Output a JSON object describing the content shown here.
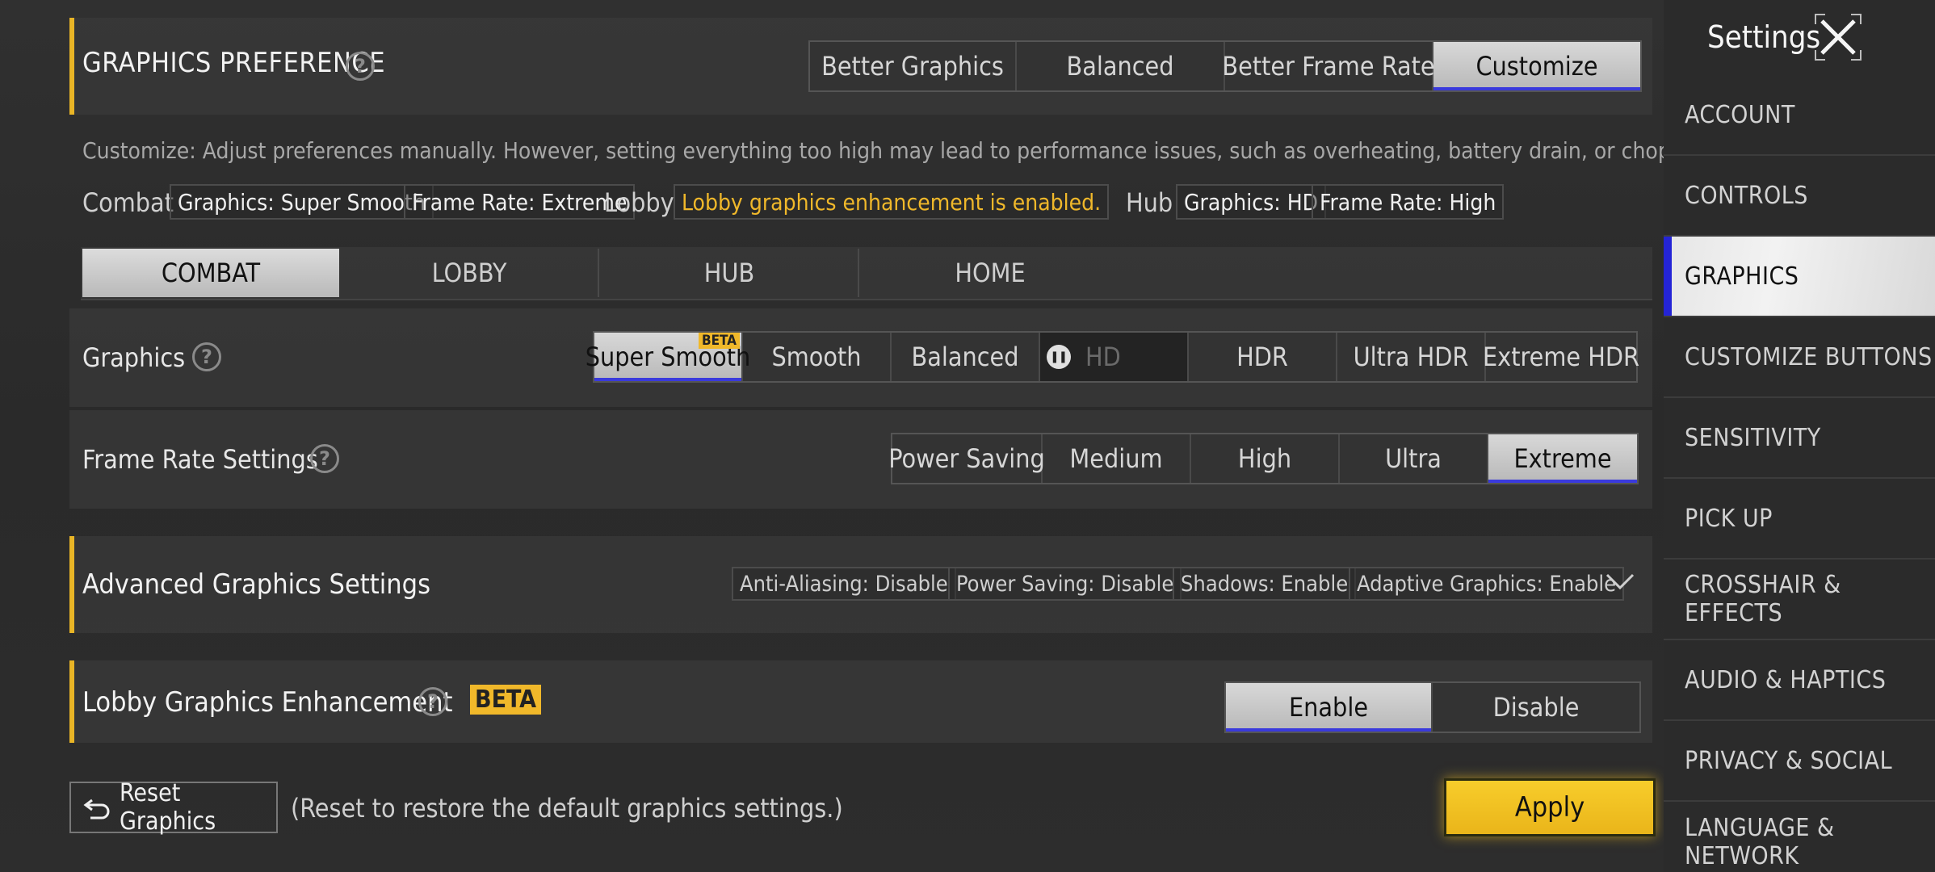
{
  "graphics_preference": {
    "title": "GRAPHICS PREFERENCE",
    "options": [
      "Better Graphics",
      "Balanced",
      "Better Frame Rate",
      "Customize"
    ],
    "selected": "Customize",
    "description": "Customize: Adjust preferences manually. However, setting everything too high may lead to performance issues, such as overheating, battery drain, or choppy gameplay."
  },
  "summary": {
    "combat_label": "Combat",
    "combat_graphics": "Graphics: Super Smooth",
    "combat_framerate": "Frame Rate: Extreme",
    "lobby_label": "Lobby",
    "lobby_status": "Lobby graphics enhancement is enabled.",
    "hub_label": "Hub",
    "hub_graphics": "Graphics: HD",
    "hub_framerate": "Frame Rate: High"
  },
  "mode_tabs": [
    "COMBAT",
    "LOBBY",
    "HUB",
    "HOME"
  ],
  "graphics": {
    "label": "Graphics",
    "options": [
      "Super Smooth",
      "Smooth",
      "Balanced",
      "HD",
      "HDR",
      "Ultra HDR",
      "Extreme HDR"
    ],
    "selected": "Super Smooth",
    "beta_badge": "BETA"
  },
  "frame_rate": {
    "label": "Frame Rate Settings",
    "options": [
      "Power Saving",
      "Medium",
      "High",
      "Ultra",
      "Extreme"
    ],
    "selected": "Extreme"
  },
  "advanced": {
    "title": "Advanced Graphics Settings",
    "tags": [
      "Anti-Aliasing: Disable",
      "Power Saving: Disable",
      "Shadows: Enable",
      "Adaptive Graphics: Enable"
    ]
  },
  "lobby_enhancement": {
    "title": "Lobby Graphics Enhancement",
    "beta_badge": "BETA",
    "options": [
      "Enable",
      "Disable"
    ],
    "selected": "Enable"
  },
  "footer": {
    "reset_label": "Reset Graphics",
    "reset_note": "(Reset to restore the default graphics settings.)",
    "apply_label": "Apply"
  },
  "sidebar": {
    "title": "Settings",
    "items": [
      "ACCOUNT",
      "CONTROLS",
      "GRAPHICS",
      "CUSTOMIZE BUTTONS",
      "SENSITIVITY",
      "PICK UP",
      "CROSSHAIR & EFFECTS",
      "AUDIO & HAPTICS",
      "PRIVACY & SOCIAL",
      "LANGUAGE & NETWORK"
    ],
    "active": "GRAPHICS"
  },
  "colors": {
    "accent": "#e9b526",
    "selected_underline": "#3a3adc",
    "apply_button": "#f3c21b"
  }
}
